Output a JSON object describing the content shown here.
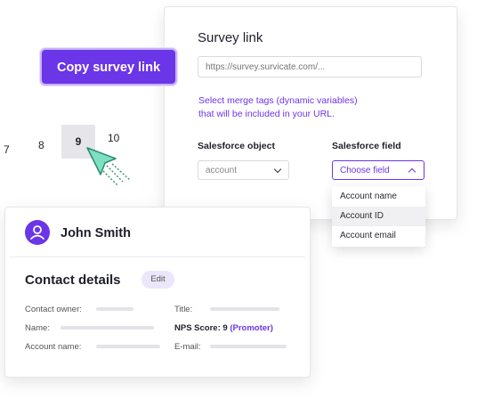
{
  "survey_card": {
    "title": "Survey link",
    "url_placeholder": "https://survey.survicate.com/...",
    "merge_hint_line1": "Select merge tags (dynamic variables)",
    "merge_hint_line2": "that will be included in your URL.",
    "sf_object_label": "Salesforce object",
    "sf_object_value": "account",
    "sf_field_label": "Salesforce field",
    "sf_field_value": "Choose field",
    "dropdown_options": [
      "Account name",
      "Account ID",
      "Account email"
    ],
    "dropdown_highlighted": "Account ID"
  },
  "copy_button": {
    "label": "Copy survey link"
  },
  "number_picker": {
    "values": [
      "7",
      "8",
      "9",
      "10"
    ],
    "selected": "9"
  },
  "contact_card": {
    "name": "John Smith",
    "section_title": "Contact details",
    "edit_label": "Edit",
    "fields": {
      "contact_owner": "Contact owner:",
      "name": "Name:",
      "account_name": "Account name:",
      "title": "Title:",
      "nps_label": "NPS Score:",
      "nps_value": "9",
      "nps_category": "(Promoter)",
      "email": "E-mail:"
    }
  },
  "colors": {
    "accent": "#6b35e8",
    "cursor": "#7ee0c2"
  },
  "icons": [
    "user-icon",
    "cursor-arrow-icon",
    "chevron-down-icon",
    "chevron-up-icon"
  ]
}
